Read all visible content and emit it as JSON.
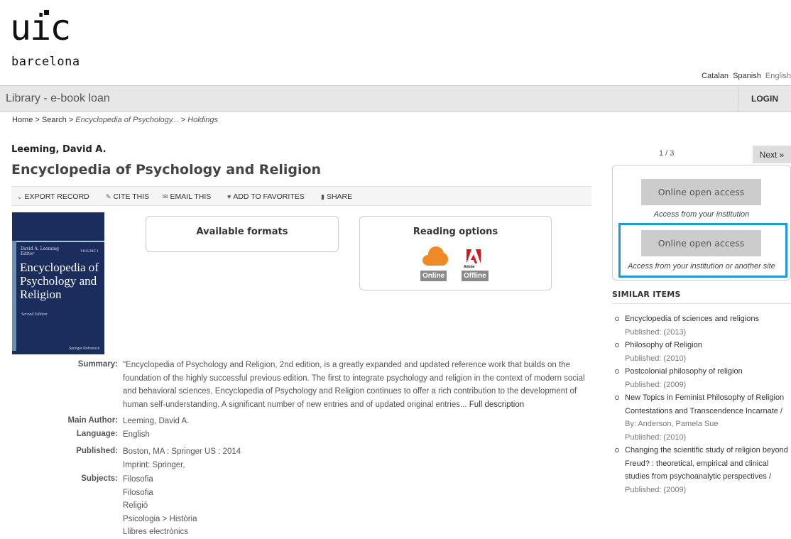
{
  "header": {
    "logo_main": "UIC",
    "logo_sub": "barcelona",
    "languages": [
      "Catalan",
      "Spanish",
      "English"
    ],
    "current_language": "English",
    "site_title": "Library - e-book loan",
    "login_label": "LOGIN"
  },
  "breadcrumb": {
    "home": "Home",
    "sep": " > ",
    "search": "Search",
    "record": "Encyclopedia of Psychology...",
    "current": "Holdings"
  },
  "record": {
    "author": "Leeming, David A.",
    "title": "Encyclopedia of Psychology and Religion"
  },
  "toolbar": {
    "export": "EXPORT RECORD",
    "cite": "CITE THIS",
    "email": "EMAIL THIS",
    "favorites": "ADD TO FAVORITES",
    "share": "SHARE"
  },
  "cover": {
    "author": "David A. Leeming",
    "author_role": "Editor",
    "volume": "VOLUME 1",
    "title": "Encyclopedia of Psychology and Religion",
    "edition": "Second Edition",
    "publisher": "Springer Reference"
  },
  "formats": {
    "available_title": "Available formats",
    "reading_title": "Reading options",
    "online_label": "Online",
    "offline_label": "Offline",
    "adobe_label": "Adobe"
  },
  "details": {
    "summary_label": "Summary:",
    "summary_text": "\"Encyclopedia of Psychology and Religion, 2nd edition, is a greatly expanded and updated reference work that builds on the foundation of the highly successful previous edition. The first to integrate psychology and religion in the context of modern social and behavioral sciences, Encyclopedia of Psychology and Religion continues to offer a rich contribution to the development of human self-understanding. A significant number of new entries and of updated original entries...",
    "full_description_link": "Full description",
    "main_author_label": "Main Author:",
    "main_author": "Leeming, David A.",
    "language_label": "Language:",
    "language": "English",
    "published_label": "Published:",
    "published": "Boston, MA : Springer US : 2014",
    "imprint": "Imprint: Springer,",
    "subjects_label": "Subjects:",
    "subjects": [
      "Filosofia",
      "Filosofia",
      "Religió",
      "Psicologia > Història",
      "Llibres electrònics"
    ]
  },
  "pager": {
    "position": "1 / 3",
    "next_label": "Next »"
  },
  "access": {
    "button1_label": "Online open access",
    "note1": "Access from your institution",
    "button2_label": "Online open access",
    "note2": "Access from your institution or another site"
  },
  "similar": {
    "heading": "SIMILAR ITEMS",
    "items": [
      {
        "title": "Encyclopedia of sciences and religions",
        "published": "Published: (2013)"
      },
      {
        "title": "Philosophy of Religion",
        "published": "Published: (2010)"
      },
      {
        "title": "Postcolonial philosophy of religion",
        "published": "Published: (2009)"
      },
      {
        "title": "New Topics in Feminist Philosophy of Religion Contestations and Transcendence Incarnate /",
        "by": "By: Anderson, Pamela Sue",
        "published": "Published: (2010)"
      },
      {
        "title": "Changing the scientific study of religion beyond Freud? : theoretical, empirical and clinical studies from psychoanalytic perspectives /",
        "published": "Published: (2009)"
      }
    ]
  },
  "colors": {
    "highlight": "#1e9bd7",
    "cloud": "#f08a24",
    "cover": "#1b2d5c"
  }
}
